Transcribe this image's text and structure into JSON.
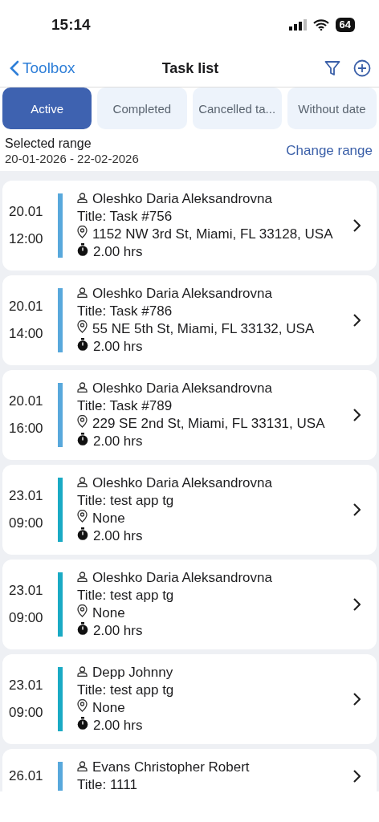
{
  "status_bar": {
    "time": "15:14",
    "battery": "64"
  },
  "nav": {
    "back": "Toolbox",
    "title": "Task list"
  },
  "tabs": [
    {
      "label": "Active",
      "selected": true
    },
    {
      "label": "Completed",
      "selected": false
    },
    {
      "label": "Cancelled ta...",
      "selected": false
    },
    {
      "label": "Without date",
      "selected": false
    }
  ],
  "range": {
    "label": "Selected range",
    "value": "20-01-2026 - 22-02-2026",
    "action": "Change range"
  },
  "tasks": [
    {
      "date": "20.01",
      "time": "12:00",
      "color": "#58a8dc",
      "assignee": "Oleshko Daria Aleksandrovna",
      "title": "Title: Task #756",
      "address": "1152 NW 3rd St, Miami, FL 33128, USA",
      "duration": "2.00 hrs"
    },
    {
      "date": "20.01",
      "time": "14:00",
      "color": "#58a8dc",
      "assignee": "Oleshko Daria Aleksandrovna",
      "title": "Title: Task #786",
      "address": "55 NE 5th St, Miami, FL 33132, USA",
      "duration": "2.00 hrs"
    },
    {
      "date": "20.01",
      "time": "16:00",
      "color": "#58a8dc",
      "assignee": "Oleshko Daria Aleksandrovna",
      "title": "Title: Task #789",
      "address": "229 SE 2nd St, Miami, FL 33131, USA",
      "duration": "2.00 hrs"
    },
    {
      "date": "23.01",
      "time": "09:00",
      "color": "#1aaac4",
      "assignee": "Oleshko Daria Aleksandrovna",
      "title": "Title: test app tg",
      "address": "None",
      "duration": "2.00 hrs"
    },
    {
      "date": "23.01",
      "time": "09:00",
      "color": "#1aaac4",
      "assignee": "Oleshko Daria Aleksandrovna",
      "title": "Title: test app tg",
      "address": "None",
      "duration": "2.00 hrs"
    },
    {
      "date": "23.01",
      "time": "09:00",
      "color": "#1aaac4",
      "assignee": "Depp Johnny",
      "title": "Title: test app tg",
      "address": "None",
      "duration": "2.00 hrs"
    },
    {
      "date": "26.01",
      "color": "#58a8dc",
      "assignee": "Evans Christopher Robert",
      "title": "Title: 1111"
    }
  ]
}
